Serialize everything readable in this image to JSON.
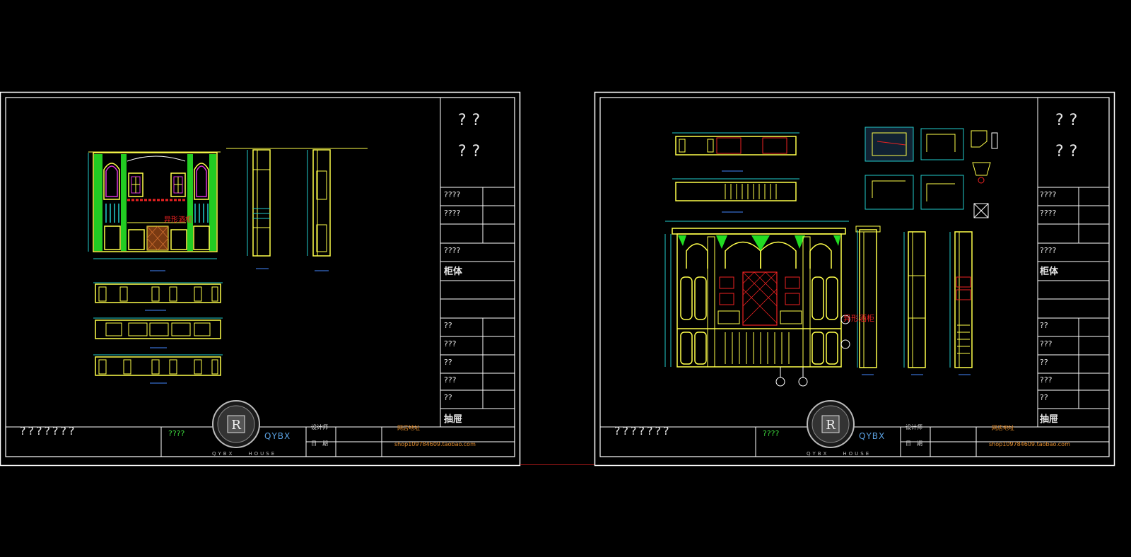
{
  "sheets": [
    {
      "title_q1": "??",
      "title_q2": "??",
      "rows": [
        "????",
        "????",
        "????",
        "柜体",
        "??",
        "???",
        "??",
        "???",
        "??",
        "抽屉"
      ],
      "footer_title": "???????",
      "footer_label": "????",
      "brand": "QYBX",
      "designer_label": "设计师",
      "date_label": "日　期",
      "shop_label": "网店地址",
      "shop_url": "shop109784609.taobao.com",
      "logo_caption": "QYBX　　HOUSE",
      "drawing_note": "异形酒柜"
    },
    {
      "title_q1": "??",
      "title_q2": "??",
      "rows": [
        "????",
        "????",
        "????",
        "柜体",
        "??",
        "???",
        "??",
        "???",
        "??",
        "抽屉"
      ],
      "footer_title": "???????",
      "footer_label": "????",
      "brand": "QYBX",
      "designer_label": "设计师",
      "date_label": "日　期",
      "shop_label": "网店地址",
      "shop_url": "shop109784609.taobao.com",
      "logo_caption": "QYBX　　HOUSE",
      "drawing_note": "异形酒柜"
    }
  ],
  "colors": {
    "frame": "#ffffff",
    "cad_yellow": "#ffff4a",
    "cad_green": "#22dd22",
    "cad_cyan": "#22cccc",
    "cad_magenta": "#dd33dd",
    "cad_red": "#ee2222",
    "cad_blue": "#4488ff"
  }
}
